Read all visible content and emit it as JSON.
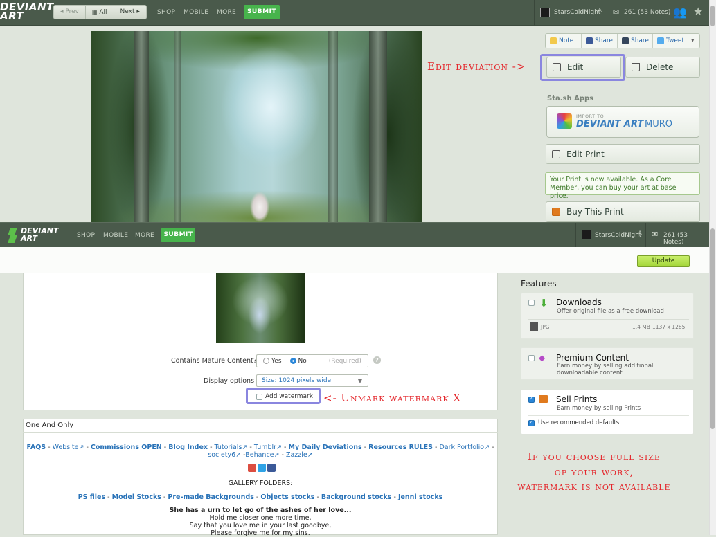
{
  "top_nav": {
    "logo": "DEVIANT ART",
    "prev": "◂ Prev",
    "all": "All",
    "next": "Next ▸",
    "links": [
      "SHOP",
      "MOBILE",
      "MORE"
    ],
    "submit": "SUBMIT",
    "username": "StarsColdNight",
    "notes": "261 (53 Notes)"
  },
  "share": {
    "note": "Note",
    "fb": "Share",
    "tumblr": "Share",
    "tweet": "Tweet"
  },
  "actions": {
    "edit": "Edit",
    "delete": "Delete",
    "stash_title": "Sta.sh Apps",
    "muro_small": "IMPORT TO",
    "muro_big": "DEVIANT ART",
    "muro_suffix": "MURO",
    "edit_print": "Edit Print",
    "print_note": "Your Print is now available. As a Core Member, you can buy your art at base price.",
    "buy_print": "Buy This Print"
  },
  "annotations": {
    "edit_deviation": "Edit deviation ->",
    "unmark": "<- Unmark watermark X",
    "full_size_1": "If you choose full size",
    "full_size_2": "of your work,",
    "full_size_3": "watermark is not available"
  },
  "bar2": {
    "logo_top": "DEVIANT",
    "logo_bottom": "ART",
    "links": [
      "SHOP",
      "MOBILE",
      "MORE"
    ],
    "submit": "SUBMIT",
    "username": "StarsColdNight",
    "notes": "261 (53 Notes)"
  },
  "form": {
    "update": "Update",
    "mature_label": "Contains Mature Content?",
    "yes": "Yes",
    "no": "No",
    "required": "(Required)",
    "display_label": "Display options",
    "display_value": "Size: 1024 pixels wide",
    "watermark": "Add watermark"
  },
  "features": {
    "title": "Features",
    "downloads": "Downloads",
    "downloads_sub": "Offer original file as a free download",
    "file_type": "JPG",
    "file_size": "1.4 MB",
    "file_dims": "1137 x 1285",
    "premium": "Premium Content",
    "premium_sub": "Earn money by selling additional downloadable content",
    "prints": "Sell Prints",
    "prints_sub": "Earn money by selling Prints",
    "defaults": "Use recommended defaults"
  },
  "description": {
    "title": "One And Only",
    "faqs": "FAQS",
    "website": "Website",
    "commissions": "Commissions OPEN",
    "blog": "Blog Index",
    "tutorials": "Tutorials",
    "tumblr": "Tumblr",
    "daily": "My Daily Deviations",
    "resources": "Resources RULES",
    "dark": "Dark Portfolio",
    "society": "society6",
    "behance": "Behance",
    "zazzle": "Zazzle",
    "gallery": "GALLERY FOLDERS:",
    "ps_files": "PS files",
    "model": "Model Stocks",
    "premade": "Pre-made Backgrounds",
    "objects": "Objects stocks",
    "background": "Background stocks",
    "jenni": "Jenni stocks",
    "poem1": "She has a urn to let go of the ashes of her love...",
    "poem2": "Hold me closer one more time,",
    "poem3": "Say that you love me in your last goodbye,",
    "poem4": "Please forgive me for my sins."
  },
  "colors": {
    "nav": "#4a5a4b",
    "submit": "#47b44c",
    "annotation": "#e4262b",
    "highlight": "#8a86df",
    "link": "#2a73b8"
  }
}
